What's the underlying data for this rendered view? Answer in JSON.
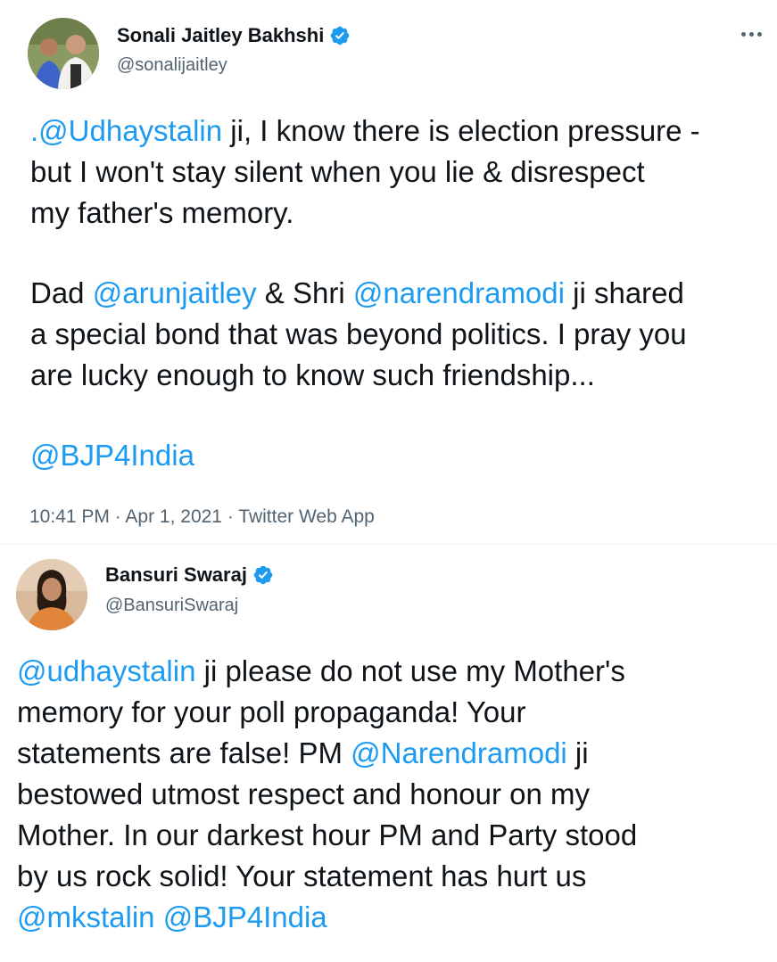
{
  "tweets": [
    {
      "author": {
        "name": "Sonali Jaitley Bakhshi",
        "handle": "@sonalijaitley",
        "verified": true
      },
      "body": {
        "l1": {
          "mention": ".@Udhaystalin",
          "rest": " ji, I know there is election pressure -"
        },
        "l2": "but I won't stay silent when you lie & disrespect",
        "l3": "my father's memory.",
        "l4": {
          "pre": "Dad ",
          "m1": "@arunjaitley",
          "mid": " & Shri ",
          "m2": "@narendramodi",
          "post": " ji shared"
        },
        "l5": "a special bond that was beyond politics. I pray you",
        "l6": "are lucky enough to know such friendship...",
        "l7": {
          "mention": "@BJP4India"
        }
      },
      "meta": {
        "time": "10:41 PM",
        "sep1": " · ",
        "date": "Apr 1, 2021",
        "sep2": " · ",
        "source": "Twitter Web App"
      }
    },
    {
      "author": {
        "name": "Bansuri Swaraj",
        "handle": "@BansuriSwaraj",
        "verified": true
      },
      "body": {
        "l1": {
          "mention": "@udhaystalin",
          "rest": " ji please do not use my Mother's"
        },
        "l2": "memory for your poll propaganda! Your",
        "l3": {
          "pre": "statements are false!  PM ",
          "mention": "@Narendramodi",
          "post": " ji"
        },
        "l4": "bestowed utmost respect and honour on my",
        "l5": "Mother. In our darkest hour PM and Party stood",
        "l6": "by us rock solid! Your statement has hurt us",
        "l7": {
          "m1": "@mkstalin",
          "sep": " ",
          "m2": "@BJP4India"
        }
      }
    }
  ],
  "colors": {
    "link": "#1d9bf0",
    "text": "#0f1419",
    "secondary": "#536471",
    "verified": "#1d9bf0"
  },
  "icons": {
    "verified": "verified-badge-icon",
    "more": "more-horizontal-icon"
  }
}
